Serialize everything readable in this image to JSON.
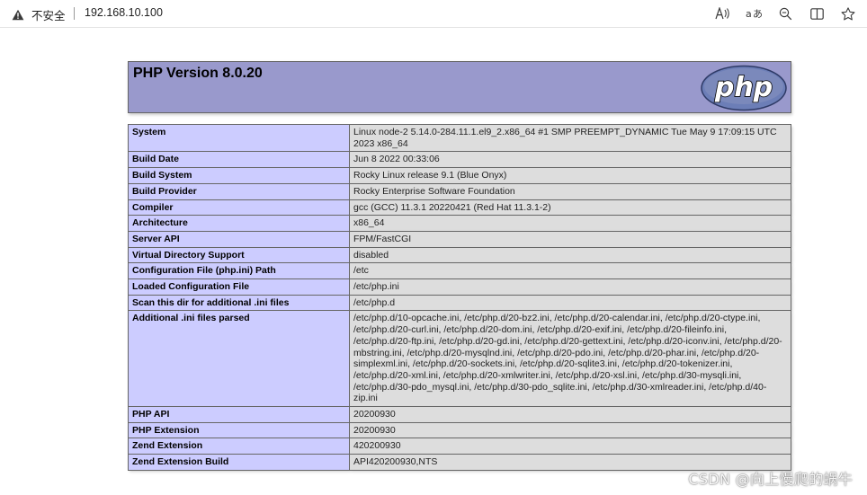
{
  "browser": {
    "security_label": "不安全",
    "url": "192.168.10.100",
    "read_aloud_icon": "Á»",
    "translate_icon": "ă",
    "icons": [
      "warning-icon",
      "read-aloud-icon",
      "translate-icon",
      "zoom-icon",
      "split-screen-icon",
      "favorite-icon"
    ]
  },
  "phpinfo": {
    "title": "PHP Version 8.0.20",
    "logo_text": "php",
    "colors": {
      "header_bg": "#9999cc",
      "key_bg": "#ccccff",
      "value_bg": "#dddddd",
      "border": "#666666"
    },
    "rows": [
      {
        "key": "System",
        "value": "Linux node-2 5.14.0-284.11.1.el9_2.x86_64 #1 SMP PREEMPT_DYNAMIC Tue May 9 17:09:15 UTC 2023 x86_64"
      },
      {
        "key": "Build Date",
        "value": "Jun 8 2022 00:33:06"
      },
      {
        "key": "Build System",
        "value": "Rocky Linux release 9.1 (Blue Onyx)"
      },
      {
        "key": "Build Provider",
        "value": "Rocky Enterprise Software Foundation"
      },
      {
        "key": "Compiler",
        "value": "gcc (GCC) 11.3.1 20220421 (Red Hat 11.3.1-2)"
      },
      {
        "key": "Architecture",
        "value": "x86_64"
      },
      {
        "key": "Server API",
        "value": "FPM/FastCGI"
      },
      {
        "key": "Virtual Directory Support",
        "value": "disabled"
      },
      {
        "key": "Configuration File (php.ini) Path",
        "value": "/etc"
      },
      {
        "key": "Loaded Configuration File",
        "value": "/etc/php.ini"
      },
      {
        "key": "Scan this dir for additional .ini files",
        "value": "/etc/php.d"
      },
      {
        "key": "Additional .ini files parsed",
        "value": "/etc/php.d/10-opcache.ini, /etc/php.d/20-bz2.ini, /etc/php.d/20-calendar.ini, /etc/php.d/20-ctype.ini, /etc/php.d/20-curl.ini, /etc/php.d/20-dom.ini, /etc/php.d/20-exif.ini, /etc/php.d/20-fileinfo.ini, /etc/php.d/20-ftp.ini, /etc/php.d/20-gd.ini, /etc/php.d/20-gettext.ini, /etc/php.d/20-iconv.ini, /etc/php.d/20-mbstring.ini, /etc/php.d/20-mysqlnd.ini, /etc/php.d/20-pdo.ini, /etc/php.d/20-phar.ini, /etc/php.d/20-simplexml.ini, /etc/php.d/20-sockets.ini, /etc/php.d/20-sqlite3.ini, /etc/php.d/20-tokenizer.ini, /etc/php.d/20-xml.ini, /etc/php.d/20-xmlwriter.ini, /etc/php.d/20-xsl.ini, /etc/php.d/30-mysqli.ini, /etc/php.d/30-pdo_mysql.ini, /etc/php.d/30-pdo_sqlite.ini, /etc/php.d/30-xmlreader.ini, /etc/php.d/40-zip.ini"
      },
      {
        "key": "PHP API",
        "value": "20200930"
      },
      {
        "key": "PHP Extension",
        "value": "20200930"
      },
      {
        "key": "Zend Extension",
        "value": "420200930"
      },
      {
        "key": "Zend Extension Build",
        "value": "API420200930,NTS"
      }
    ]
  },
  "watermark": "CSDN @向上慢爬的蜗牛"
}
